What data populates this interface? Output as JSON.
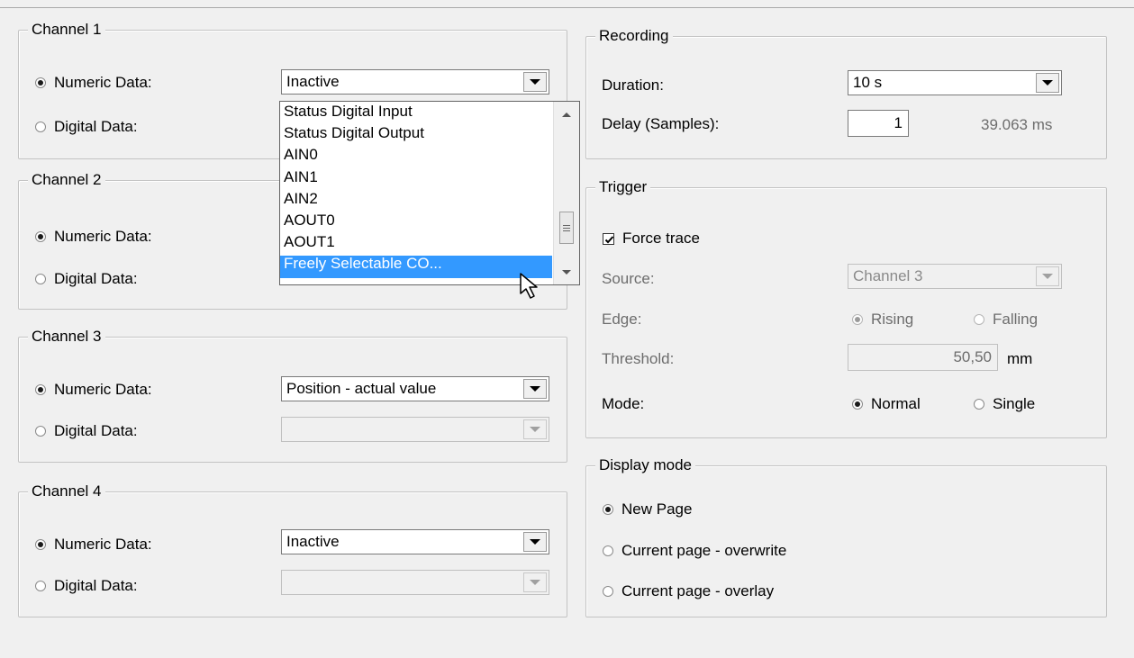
{
  "channels": [
    {
      "title": "Channel 1",
      "numeric_label": "Numeric Data:",
      "digital_label": "Digital Data:",
      "numeric_value": "Inactive",
      "digital_value": ""
    },
    {
      "title": "Channel 2",
      "numeric_label": "Numeric Data:",
      "digital_label": "Digital Data:",
      "numeric_value": "",
      "digital_value": ""
    },
    {
      "title": "Channel 3",
      "numeric_label": "Numeric Data:",
      "digital_label": "Digital Data:",
      "numeric_value": "Position - actual value",
      "digital_value": ""
    },
    {
      "title": "Channel 4",
      "numeric_label": "Numeric Data:",
      "digital_label": "Digital Data:",
      "numeric_value": "Inactive",
      "digital_value": ""
    }
  ],
  "dropdown": {
    "items": [
      "Status Digital Input",
      "Status Digital Output",
      "AIN0",
      "AIN1",
      "AIN2",
      "AOUT0",
      "AOUT1"
    ],
    "selected": "Freely Selectable CO..."
  },
  "recording": {
    "title": "Recording",
    "duration_label": "Duration:",
    "duration_value": "10 s",
    "delay_label": "Delay (Samples):",
    "delay_value": "1",
    "delay_time": "39.063 ms"
  },
  "trigger": {
    "title": "Trigger",
    "force_trace_label": "Force trace",
    "force_trace_checked": true,
    "source_label": "Source:",
    "source_value": "Channel 3",
    "edge_label": "Edge:",
    "edge_rising": "Rising",
    "edge_falling": "Falling",
    "threshold_label": "Threshold:",
    "threshold_value": "50,50",
    "threshold_unit": "mm",
    "mode_label": "Mode:",
    "mode_normal": "Normal",
    "mode_single": "Single"
  },
  "display_mode": {
    "title": "Display mode",
    "options": [
      "New Page",
      "Current page - overwrite",
      "Current page - overlay"
    ],
    "selected": "New Page"
  }
}
